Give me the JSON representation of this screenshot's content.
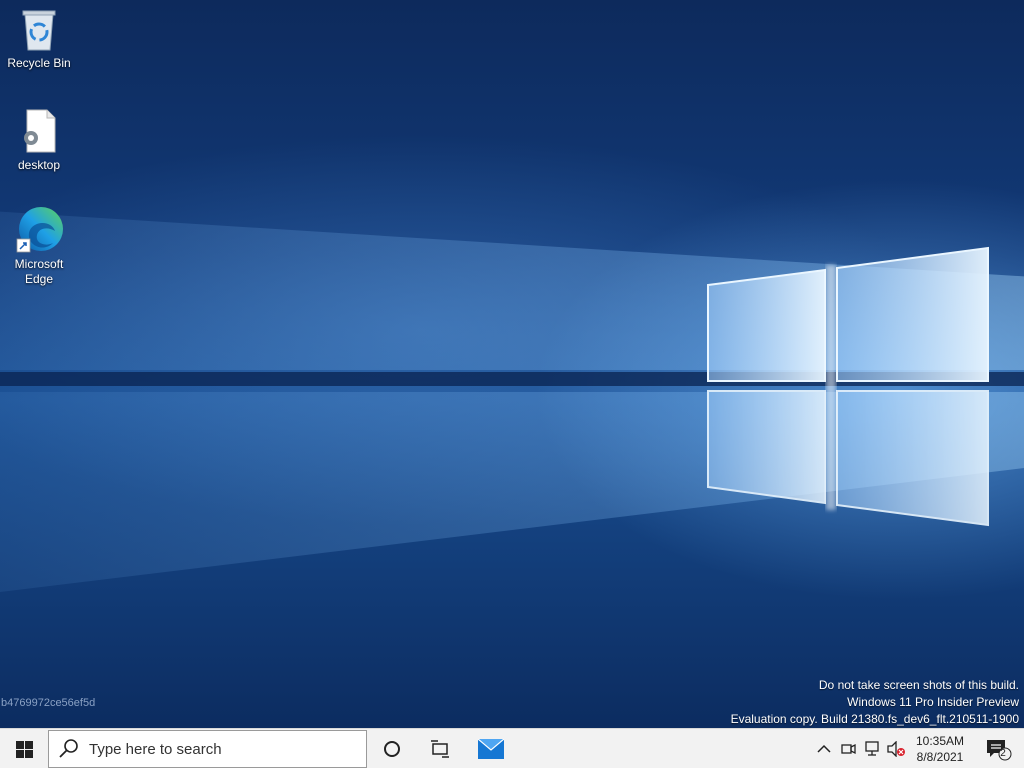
{
  "desktop": {
    "icons": [
      {
        "label": "Recycle Bin",
        "icon": "recycle-bin-icon"
      },
      {
        "label": "desktop",
        "icon": "settings-file-icon"
      },
      {
        "label": "Microsoft Edge",
        "icon": "edge-icon"
      }
    ],
    "build_id": "b4769972ce56ef5d",
    "watermark": {
      "line1": "Do not take screen shots of this build.",
      "line2": "Windows 11 Pro Insider Preview",
      "line3": "Evaluation copy. Build 21380.fs_dev6_flt.210511-1900"
    }
  },
  "taskbar": {
    "start_icon": "windows-start-icon",
    "search_placeholder": "Type here to search",
    "cortana_icon": "cortana-icon",
    "task_view_icon": "task-view-icon",
    "mail_icon": "mail-icon",
    "tray": {
      "chevron_icon": "chevron-up-icon",
      "time": "10:35AM",
      "date": "8/8/2021",
      "notification_count": "2"
    }
  },
  "colors": {
    "accent": "#0078d4",
    "taskbar_bg": "#f2f2f2"
  }
}
